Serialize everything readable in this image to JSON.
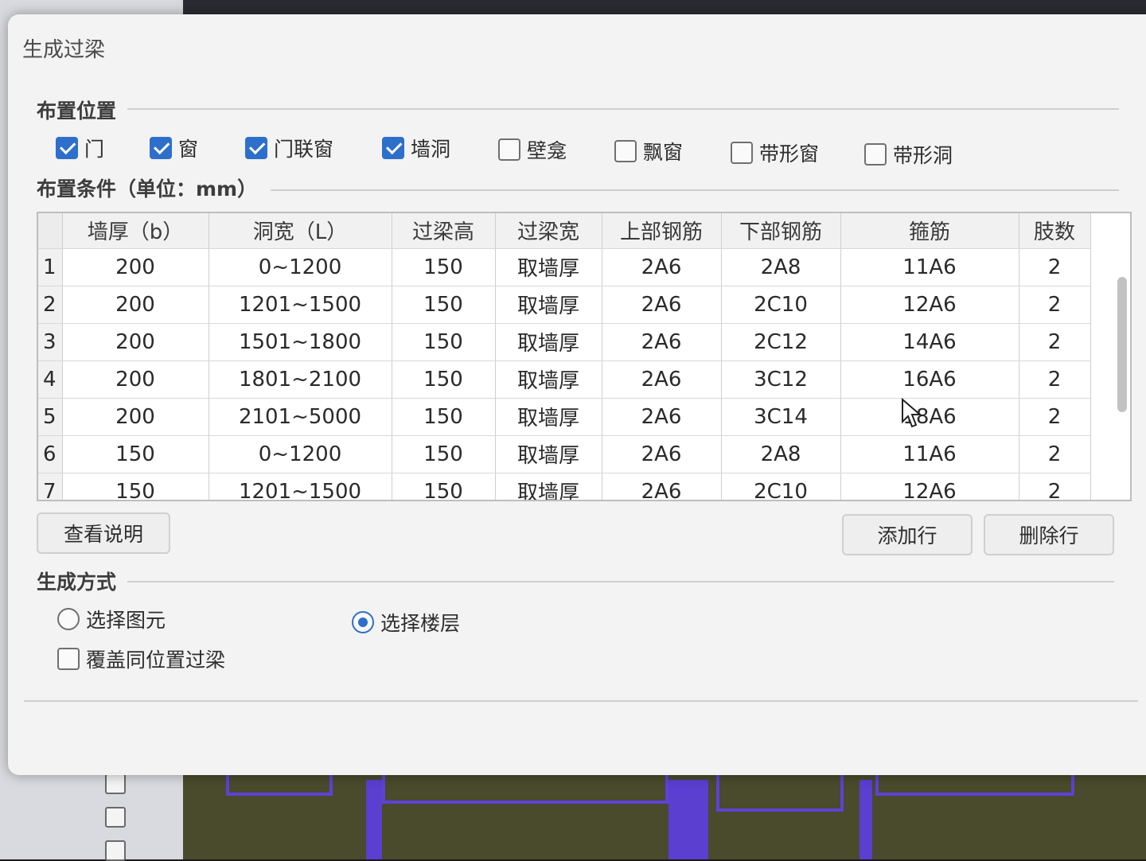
{
  "dialog": {
    "title": "生成过梁"
  },
  "placement": {
    "section_title": "布置位置",
    "options": [
      {
        "label": "门",
        "checked": true
      },
      {
        "label": "窗",
        "checked": true
      },
      {
        "label": "门联窗",
        "checked": true
      },
      {
        "label": "墙洞",
        "checked": true
      },
      {
        "label": "壁龛",
        "checked": false
      },
      {
        "label": "飘窗",
        "checked": false
      },
      {
        "label": "带形窗",
        "checked": false
      },
      {
        "label": "带形洞",
        "checked": false
      }
    ]
  },
  "conditions": {
    "section_title": "布置条件（单位：mm）",
    "columns": [
      "",
      "墙厚（b）",
      "洞宽（L）",
      "过梁高",
      "过梁宽",
      "上部钢筋",
      "下部钢筋",
      "箍筋",
      "肢数"
    ],
    "rows": [
      [
        "1",
        "200",
        "0~1200",
        "150",
        "取墙厚",
        "2A6",
        "2A8",
        "11A6",
        "2"
      ],
      [
        "2",
        "200",
        "1201~1500",
        "150",
        "取墙厚",
        "2A6",
        "2C10",
        "12A6",
        "2"
      ],
      [
        "3",
        "200",
        "1501~1800",
        "150",
        "取墙厚",
        "2A6",
        "2C12",
        "14A6",
        "2"
      ],
      [
        "4",
        "200",
        "1801~2100",
        "150",
        "取墙厚",
        "2A6",
        "3C12",
        "16A6",
        "2"
      ],
      [
        "5",
        "200",
        "2101~5000",
        "150",
        "取墙厚",
        "2A6",
        "3C14",
        "18A6",
        "2"
      ],
      [
        "6",
        "150",
        "0~1200",
        "150",
        "取墙厚",
        "2A6",
        "2A8",
        "11A6",
        "2"
      ],
      [
        "7",
        "150",
        "1201~1500",
        "150",
        "取墙厚",
        "2A6",
        "2C10",
        "12A6",
        "2"
      ]
    ]
  },
  "buttons": {
    "view_help": "查看说明",
    "add_row": "添加行",
    "delete_row": "删除行"
  },
  "generation": {
    "section_title": "生成方式",
    "radio_select_element": "选择图元",
    "radio_select_floor": "选择楼层",
    "selected": "选择楼层",
    "overwrite_label": "覆盖同位置过梁",
    "overwrite_checked": false
  },
  "colors": {
    "accent": "#2d6fcb",
    "cad_purple": "#5a3fd0",
    "cad_olive": "#4a4a2c"
  }
}
